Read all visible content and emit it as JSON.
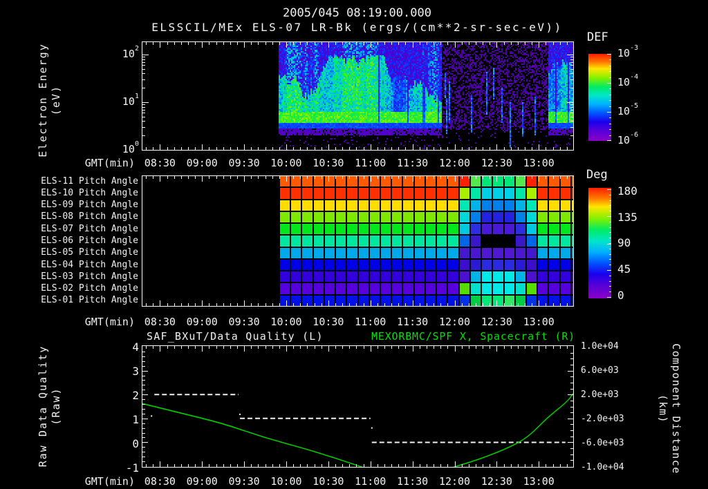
{
  "header": {
    "title": "2005/045 08:19:00.000",
    "subtitle": "ELSSCIL/MEx ELS-07 LR-Bk  (ergs/(cm**2-sr-sec-eV))"
  },
  "time_axis": {
    "label": "GMT(min)",
    "tick_labels": [
      "08:30",
      "09:00",
      "09:30",
      "10:00",
      "10:30",
      "11:00",
      "11:30",
      "12:00",
      "12:30",
      "13:00"
    ],
    "start": "08:17",
    "end": "13:25",
    "major_step_min": 30,
    "minor_step_min": 5
  },
  "energy_panel": {
    "ylabel": "Electron Energy",
    "ylabel_unit": "(eV)",
    "ytick_exponents": [
      "2",
      "1",
      "0"
    ],
    "colorbar": {
      "title": "DEF",
      "tick_exponents": [
        "-3",
        "-4",
        "-5",
        "-6"
      ]
    }
  },
  "pitch_panel": {
    "row_labels": [
      "ELS-11 Pitch Angle",
      "ELS-10 Pitch Angle",
      "ELS-09 Pitch Angle",
      "ELS-08 Pitch Angle",
      "ELS-07 Pitch Angle",
      "ELS-06 Pitch Angle",
      "ELS-05 Pitch Angle",
      "ELS-04 Pitch Angle",
      "ELS-03 Pitch Angle",
      "ELS-02 Pitch Angle",
      "ELS-01 Pitch Angle"
    ],
    "colorbar": {
      "title": "Deg",
      "tick_labels": [
        "180",
        "135",
        "90",
        "45",
        "0"
      ]
    }
  },
  "quality_panel": {
    "title_left": "SAF_BXuT/Data Quality (L)",
    "title_right": "MEXORBMC/SPF X, Spacecraft (R)",
    "title_right_color": "#00e000",
    "ylabel_left": "Raw Data Quality",
    "ylabel_left_unit": "(Raw)",
    "ylabel_right": "Component Distance",
    "ylabel_right_unit": "(km)",
    "ytick_labels_left": [
      "4",
      "3",
      "2",
      "1",
      "0",
      "-1"
    ],
    "ytick_labels_right": [
      "1.0e+04",
      "6.0e+03",
      "2.0e+03",
      "-2.0e+03",
      "-6.0e+03",
      "-1.0e+04"
    ]
  },
  "colors": {
    "background": "#000000",
    "text": "#f2f2f2",
    "accent_green": "#00e000",
    "rainbow_stops": [
      [
        0,
        "#ff1e00"
      ],
      [
        0.09,
        "#ff7300"
      ],
      [
        0.17,
        "#ffe600"
      ],
      [
        0.28,
        "#80f000"
      ],
      [
        0.38,
        "#00ec64"
      ],
      [
        0.48,
        "#00e6c8"
      ],
      [
        0.58,
        "#00b0ff"
      ],
      [
        0.68,
        "#0055ff"
      ],
      [
        0.78,
        "#1a00ee"
      ],
      [
        0.88,
        "#5500d8"
      ],
      [
        1,
        "#8a00c8"
      ]
    ],
    "spec_stops": [
      [
        0,
        "#2a0060"
      ],
      [
        0.12,
        "#5a00c0"
      ],
      [
        0.22,
        "#2a10f0"
      ],
      [
        0.34,
        "#0050ff"
      ],
      [
        0.46,
        "#00aaf0"
      ],
      [
        0.58,
        "#00e0c0"
      ],
      [
        0.7,
        "#00e860"
      ],
      [
        0.82,
        "#3cee20"
      ],
      [
        0.92,
        "#9cf000"
      ],
      [
        1,
        "#e0ff20"
      ]
    ]
  },
  "chart_data": [
    {
      "type": "heatmap",
      "name": "electron-energy-spectrogram",
      "title": "ELSSCIL/MEx ELS-07 LR-Bk",
      "unit": "ergs/(cm**2-sr-sec-eV)",
      "x_start": "08:17",
      "x_end": "13:25",
      "x_start_min": 497,
      "x_end_min": 805,
      "y_scale": "log",
      "y_range_ev": [
        1,
        190
      ],
      "color_range_log10": [
        -6,
        -3
      ],
      "data_start_min": 595,
      "segments": [
        {
          "start": "09:55",
          "end": "11:50",
          "start_min": 595,
          "end_min": 710,
          "intensity": "high",
          "description": "broad green-cyan electron flux 4-60 eV, purple-blue noise above 80 eV, bright green band at 3-4 eV, purple speckle below 3 eV"
        },
        {
          "start": "11:50",
          "end": "13:05",
          "start_min": 710,
          "end_min": 786,
          "intensity": "low",
          "description": "sparse purple-blue noise with occasional faint blue vertical streaks"
        },
        {
          "start": "13:05",
          "end": "13:25",
          "start_min": 786,
          "end_min": 805,
          "intensity": "high",
          "description": "green-cyan flux resumes, yellow-green spot near lower right edge"
        }
      ]
    },
    {
      "type": "heatmap",
      "name": "pitch-angle-panel",
      "data_start_min": 595,
      "column_minutes": 8,
      "rows": [
        {
          "label": "ELS-11 Pitch Angle",
          "deg": 160,
          "color": "#ff5a00"
        },
        {
          "label": "ELS-10 Pitch Angle",
          "deg": 172,
          "color": "#ff3000"
        },
        {
          "label": "ELS-09 Pitch Angle",
          "deg": 135,
          "color": "#ffdd00"
        },
        {
          "label": "ELS-08 Pitch Angle",
          "deg": 118,
          "color": "#7ee800"
        },
        {
          "label": "ELS-07 Pitch Angle",
          "deg": 104,
          "color": "#00e81c"
        },
        {
          "label": "ELS-06 Pitch Angle",
          "deg": 88,
          "color": "#00e8a0"
        },
        {
          "label": "ELS-05 Pitch Angle",
          "deg": 68,
          "color": "#00aae8"
        },
        {
          "label": "ELS-04 Pitch Angle",
          "deg": 42,
          "color": "#0000e8"
        },
        {
          "label": "ELS-03 Pitch Angle",
          "deg": 28,
          "color": "#3300dd"
        },
        {
          "label": "ELS-02 Pitch Angle",
          "deg": 14,
          "color": "#5500dd"
        },
        {
          "label": "ELS-01 Pitch Angle",
          "deg": 38,
          "color": "#0011e8"
        }
      ],
      "feature": {
        "center": "12:30",
        "center_min": 750,
        "half_width_min": 29,
        "description": "pitch-angle excursion centered near 12:30; colors sweep toward opposite angles; ELS-06 shows black data gap at center",
        "row_colors": [
          [
            "#ff2200",
            "#55e84c",
            "#00e878",
            "#00e878"
          ],
          [
            "#aaee00",
            "#00e8a8",
            "#00d0e8",
            "#00d0e8"
          ],
          [
            "#00e8b4",
            "#00b4e8",
            "#0080e8",
            "#0080e8"
          ],
          [
            "#00d8d8",
            "#0080e8",
            "#2222e0",
            "#2222e0"
          ],
          [
            "#00c8e0",
            "#2e2ee0",
            "#4a18d8",
            "#4a18d8"
          ],
          [
            "#0066e8",
            "#3a18c8",
            "#000000",
            "#000000"
          ],
          [
            "#4418cc",
            "#4a18d0",
            "#5018d0",
            "#5018d0"
          ],
          [
            "#3a0ecc",
            "#2a1ad4",
            "#2a2ae0",
            "#2a2ae0"
          ],
          [
            "#4c10d0",
            "#00b4e8",
            "#00e8e8",
            "#00e8e8"
          ],
          [
            "#55dd00",
            "#00e0cc",
            "#00e8e8",
            "#00e8e8"
          ],
          [
            "#0033e8",
            "#00cc44",
            "#33e866",
            "#00e878"
          ]
        ]
      }
    },
    {
      "type": "line",
      "name": "quality-and-spacecraft-x",
      "ylim_left": [
        -1,
        4
      ],
      "ylim_right": [
        -10000,
        10000
      ],
      "series": [
        {
          "name": "SAF_BXuT/Data Quality (L)",
          "axis": "left",
          "style": "dashed",
          "color": "#f2f2f2",
          "steps": [
            {
              "start": "08:26",
              "end": "09:26",
              "start_min": 506,
              "end_min": 566,
              "value": 2
            },
            {
              "start": "09:27",
              "end": "11:00",
              "start_min": 567,
              "end_min": 660,
              "value": 1
            },
            {
              "start": "11:01",
              "end": "13:19",
              "start_min": 661,
              "end_min": 799,
              "value": 0
            }
          ],
          "dots": [
            [
              504,
              1.1
            ],
            [
              567,
              1.17
            ],
            [
              661,
              0.6
            ]
          ]
        },
        {
          "name": "MEXORBMC/SPF X, Spacecraft (R)",
          "axis": "right",
          "style": "solid",
          "color": "#00c800",
          "points_min_km": [
            [
              497,
              500
            ],
            [
              524,
              -1070
            ],
            [
              554,
              -2770
            ],
            [
              585,
              -5250
            ],
            [
              615,
              -7175
            ],
            [
              635,
              -8640
            ],
            [
              651,
              -9890
            ],
            [
              663,
              -10900
            ],
            [
              678,
              -11500
            ],
            [
              694,
              -11550
            ],
            [
              708,
              -11000
            ],
            [
              722,
              -9950
            ],
            [
              736,
              -8980
            ],
            [
              756,
              -7175
            ],
            [
              772,
              -5250
            ],
            [
              786,
              -1860
            ],
            [
              800,
              730
            ],
            [
              805,
              2300
            ]
          ]
        }
      ]
    }
  ]
}
